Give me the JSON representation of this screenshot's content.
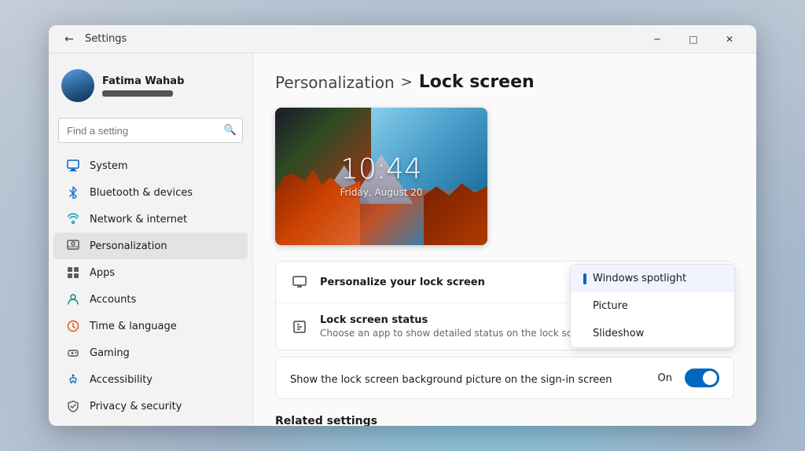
{
  "window": {
    "title": "Settings",
    "back_icon": "←",
    "min_icon": "─",
    "max_icon": "□",
    "close_icon": "✕"
  },
  "sidebar": {
    "user": {
      "name": "Fatima Wahab"
    },
    "search": {
      "placeholder": "Find a setting"
    },
    "items": [
      {
        "id": "system",
        "label": "System",
        "icon": "system"
      },
      {
        "id": "bluetooth",
        "label": "Bluetooth & devices",
        "icon": "bluetooth"
      },
      {
        "id": "network",
        "label": "Network & internet",
        "icon": "network"
      },
      {
        "id": "personalization",
        "label": "Personalization",
        "icon": "personalization",
        "active": true
      },
      {
        "id": "apps",
        "label": "Apps",
        "icon": "apps"
      },
      {
        "id": "accounts",
        "label": "Accounts",
        "icon": "accounts"
      },
      {
        "id": "time",
        "label": "Time & language",
        "icon": "time"
      },
      {
        "id": "gaming",
        "label": "Gaming",
        "icon": "gaming"
      },
      {
        "id": "accessibility",
        "label": "Accessibility",
        "icon": "accessibility"
      },
      {
        "id": "privacy",
        "label": "Privacy & security",
        "icon": "privacy"
      }
    ]
  },
  "breadcrumb": {
    "parent": "Personalization",
    "separator": ">",
    "current": "Lock screen"
  },
  "lock_preview": {
    "time": "10:44",
    "date": "Friday, August 20"
  },
  "settings": {
    "personalize_row": {
      "title": "Personalize your lock screen",
      "icon": "monitor-icon"
    },
    "lock_status_row": {
      "title": "Lock screen status",
      "description": "Choose an app to show detailed status on the lock screen",
      "icon": "status-icon"
    },
    "dropdown": {
      "options": [
        {
          "label": "Windows spotlight",
          "selected": true
        },
        {
          "label": "Picture",
          "selected": false
        },
        {
          "label": "Slideshow",
          "selected": false
        }
      ]
    },
    "sign_in_row": {
      "label": "Show the lock screen background picture on the sign-in screen",
      "status": "On",
      "enabled": true
    },
    "related_settings": {
      "label": "Related settings"
    }
  }
}
